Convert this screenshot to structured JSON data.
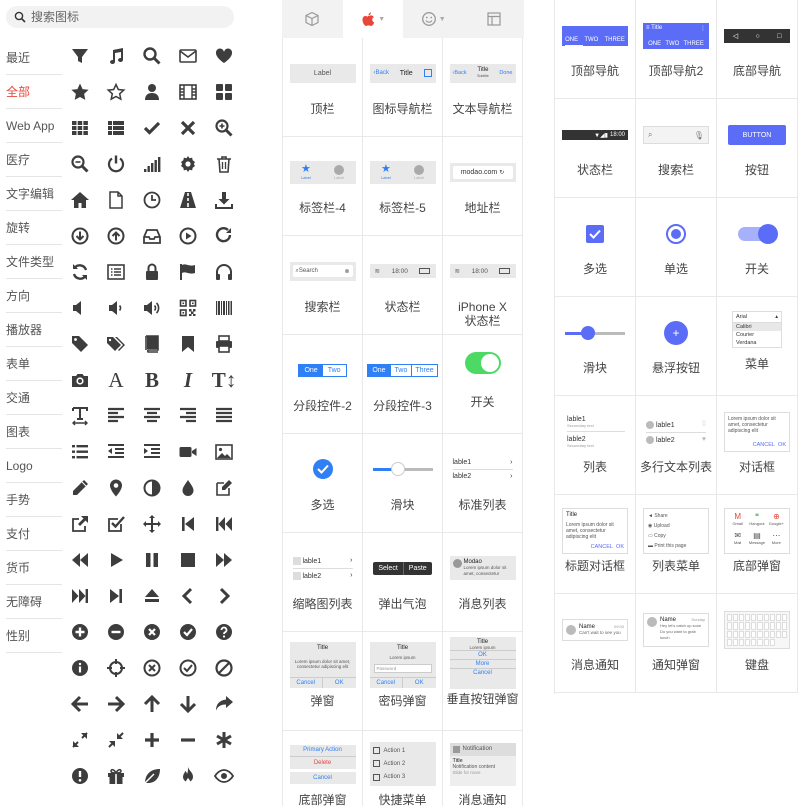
{
  "search": {
    "placeholder": "搜索图标"
  },
  "categories": [
    {
      "label": "最近"
    },
    {
      "label": "全部",
      "active": true
    },
    {
      "label": "Web App"
    },
    {
      "label": "医疗"
    },
    {
      "label": "文字编辑"
    },
    {
      "label": "旋转"
    },
    {
      "label": "文件类型"
    },
    {
      "label": "方向"
    },
    {
      "label": "播放器"
    },
    {
      "label": "表单"
    },
    {
      "label": "交通"
    },
    {
      "label": "图表"
    },
    {
      "label": "Logo"
    },
    {
      "label": "手势"
    },
    {
      "label": "支付"
    },
    {
      "label": "货币"
    },
    {
      "label": "无障碍"
    },
    {
      "label": "性别"
    }
  ],
  "icons": [
    "filter",
    "music",
    "search",
    "envelope",
    "heart",
    "star",
    "star-o",
    "user",
    "film",
    "th-large",
    "th",
    "th-list",
    "check",
    "times",
    "search-plus",
    "search-minus",
    "power-off",
    "signal",
    "cog",
    "trash",
    "home",
    "file-o",
    "clock",
    "road",
    "download",
    "arrow-circle-down",
    "arrow-circle-up",
    "inbox",
    "play-circle",
    "repeat",
    "refresh",
    "list-alt",
    "lock",
    "flag",
    "headphones",
    "volume-off",
    "volume-down",
    "volume-up",
    "qrcode",
    "barcode",
    "tag",
    "tags",
    "book",
    "bookmark",
    "print",
    "camera",
    "font",
    "bold",
    "italic",
    "text-height",
    "text-width",
    "align-left",
    "align-center",
    "align-right",
    "align-justify",
    "list",
    "outdent",
    "indent",
    "video-camera",
    "picture",
    "pencil",
    "map-marker",
    "adjust",
    "tint",
    "edit",
    "share-square",
    "check-square",
    "arrows",
    "step-backward",
    "fast-backward",
    "backward",
    "play",
    "pause",
    "stop",
    "forward",
    "fast-forward",
    "step-forward",
    "eject",
    "chevron-left",
    "chevron-right",
    "plus-circle",
    "minus-circle",
    "times-circle",
    "check-circle",
    "question-circle",
    "info-circle",
    "crosshairs",
    "times-circle-o",
    "check-circle-o",
    "ban",
    "arrow-left",
    "arrow-right",
    "arrow-up",
    "arrow-down",
    "share",
    "expand",
    "compress",
    "plus",
    "minus",
    "asterisk",
    "exclamation-circle",
    "gift",
    "leaf",
    "fire",
    "eye"
  ],
  "icon_text": {
    "font": "A",
    "bold": "B",
    "italic": "I",
    "text-height": "T↕"
  },
  "mid_tabs": [
    {
      "icon": "cube-icon"
    },
    {
      "icon": "apple-icon",
      "active": true
    },
    {
      "icon": "smile-icon"
    },
    {
      "icon": "layout-icon"
    }
  ],
  "ios": {
    "topbar": {
      "label": "顶栏",
      "text": "Label"
    },
    "icon_nav": {
      "label": "图标导航栏",
      "back": "Back",
      "title": "Title"
    },
    "text_nav": {
      "label": "文本导航栏",
      "back": "Back",
      "title": "Title",
      "subtitle": "Subtitle",
      "done": "Done"
    },
    "tabbar4": {
      "label": "标签栏-4",
      "a": "Label",
      "b": "Label"
    },
    "tabbar5": {
      "label": "标签栏-5",
      "a": "Label",
      "b": "Label"
    },
    "address": {
      "label": "地址栏",
      "url": "modao.com"
    },
    "searchbar": {
      "label": "搜索栏",
      "text": "Search"
    },
    "statusbar": {
      "label": "状态栏",
      "time": "18:00"
    },
    "iphonex": {
      "label": "iPhone X 状态栏",
      "time": "18:00"
    },
    "seg2": {
      "label": "分段控件-2",
      "a": "One",
      "b": "Two"
    },
    "seg3": {
      "label": "分段控件-3",
      "a": "One",
      "b": "Two",
      "c": "Three"
    },
    "switch": {
      "label": "开关"
    },
    "checkbox": {
      "label": "多选"
    },
    "slider": {
      "label": "滑块"
    },
    "list": {
      "label": "标准列表",
      "a": "lable1",
      "b": "lable2"
    },
    "thumb_list": {
      "label": "缩略图列表",
      "a": "lable1",
      "b": "lable2"
    },
    "popover": {
      "label": "弹出气泡",
      "a": "Select",
      "b": "Paste"
    },
    "msg_list": {
      "label": "消息列表",
      "title": "Modao",
      "body": "Lorem ipsum dolor sit amet, consectetur"
    },
    "alert": {
      "label": "弹窗",
      "title": "Title",
      "body": "Lorem ipsum dolor sit amet, consectetur adipiscing elit",
      "cancel": "Cancel",
      "ok": "OK"
    },
    "pw_alert": {
      "label": "密码弹窗",
      "title": "Title",
      "body": "Lorem ipsum",
      "field": "Password",
      "cancel": "Cancel",
      "ok": "OK"
    },
    "vert_alert": {
      "label": "垂直按钮弹窗",
      "title": "Title",
      "body": "Lorem ipsum",
      "a": "OK",
      "b": "More",
      "c": "Cancel"
    },
    "bottom_sheet": {
      "label": "底部弹窗",
      "a": "Primary Action",
      "b": "Delete",
      "c": "Cancel"
    },
    "quick_menu": {
      "label": "快捷菜单",
      "a": "Action 1",
      "b": "Action 2",
      "c": "Action 3"
    },
    "notification": {
      "label": "消息通知",
      "head": "Notification",
      "title": "Title",
      "body": "Notification content",
      "more": "Slide for more"
    }
  },
  "md": {
    "top_nav": {
      "label": "顶部导航",
      "a": "ONE",
      "b": "TWO",
      "c": "THREE"
    },
    "top_nav2": {
      "label": "顶部导航2",
      "title": "Title",
      "a": "ONE",
      "b": "TWO",
      "c": "THREE"
    },
    "bottom_nav": {
      "label": "底部导航"
    },
    "statusbar": {
      "label": "状态栏",
      "time": "18:00"
    },
    "search": {
      "label": "搜索栏"
    },
    "button": {
      "label": "按钮",
      "text": "BUTTON"
    },
    "checkbox": {
      "label": "多选"
    },
    "radio": {
      "label": "单选"
    },
    "switch": {
      "label": "开关"
    },
    "slider": {
      "label": "滑块"
    },
    "fab": {
      "label": "悬浮按钮"
    },
    "menu": {
      "label": "菜单",
      "head": "Arial",
      "a": "Calibri",
      "b": "Courier",
      "c": "Verdana"
    },
    "list": {
      "label": "列表",
      "a": "lable1",
      "a_sub": "Secondary text",
      "b": "lable2",
      "b_sub": "Secondary text"
    },
    "multi_list": {
      "label": "多行文本列表",
      "a": "lable1",
      "b": "lable2"
    },
    "dialog": {
      "label": "对话框",
      "body": "Lorem ipsum dolor sit amet, consectetur adipiscing elit",
      "cancel": "CANCEL",
      "ok": "OK"
    },
    "title_dialog": {
      "label": "标题对话框",
      "title": "Title",
      "body": "Lorem ipsum dolor sit amet, consectetur adipiscing elit",
      "cancel": "CANCEL",
      "ok": "OK"
    },
    "list_menu": {
      "label": "列表菜单",
      "a": "Share",
      "b": "Upload",
      "c": "Copy",
      "d": "Print this page"
    },
    "bottom_sheet": {
      "label": "底部弹窗",
      "a": "Gmail",
      "b": "Hangout",
      "c": "Google+",
      "d": "Mail",
      "e": "Message",
      "f": "More"
    },
    "msg_notify": {
      "label": "消息通知",
      "name": "Name",
      "time": "09:00",
      "body": "Can't wait to see you"
    },
    "notify_popup": {
      "label": "通知弹窗",
      "name": "Name",
      "time": "Sunday",
      "body": "Hey let's catch up soon Do you want to grab lunch"
    },
    "keyboard": {
      "label": "键盘"
    }
  },
  "colors": {
    "accent": "#e8463b",
    "ios_blue": "#2f7ff5",
    "md_indigo": "#5b6cf7",
    "switch_green": "#4cd964"
  }
}
